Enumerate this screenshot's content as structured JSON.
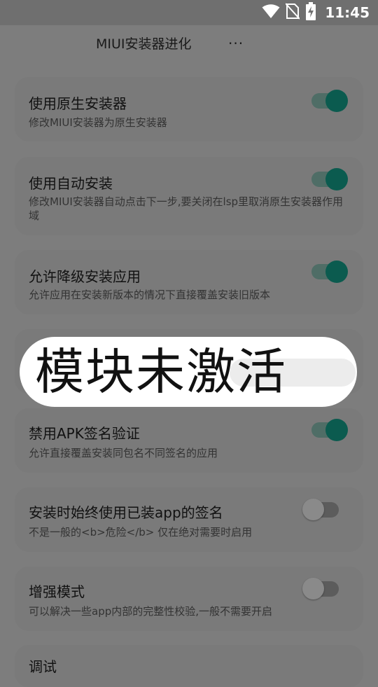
{
  "status_bar": {
    "time": "11:45",
    "icons": [
      "wifi-icon",
      "no-sim-icon",
      "battery-charging-icon"
    ]
  },
  "app_bar": {
    "title": "MIUI安装器进化",
    "more": "..."
  },
  "settings": [
    {
      "title": "使用原生安装器",
      "subtitle": "修改MIUI安装器为原生安装器",
      "enabled": true
    },
    {
      "title": "使用自动安装",
      "subtitle": "修改MIUI安装器自动点击下一步,要关闭在lsp里取消原生安装器作用域",
      "enabled": true
    },
    {
      "title": "允许降级安装应用",
      "subtitle": "允许应用在安装新版本的情况下直接覆盖安装旧版本",
      "enabled": true
    },
    {
      "title": "禁用APK签名验证",
      "subtitle": "允许直接覆盖安装同包名不同签名的应用",
      "enabled": true
    },
    {
      "title": "安装时始终使用已装app的签名",
      "subtitle": "不是一般的<b>危险</b> 仅在绝对需要时启用",
      "enabled": false
    },
    {
      "title": "增强模式",
      "subtitle": "可以解决一些app内部的完整性校验,一般不需要开启",
      "enabled": false
    },
    {
      "title": "调试",
      "subtitle": "",
      "enabled": false
    }
  ],
  "toast": {
    "message": "模块未激活"
  },
  "colors": {
    "overlay_background": "#7d7d7d",
    "card_background": "#7a7a7a",
    "toggle_on_thumb": "#0b5b4f",
    "toast_background": "#ffffff"
  }
}
